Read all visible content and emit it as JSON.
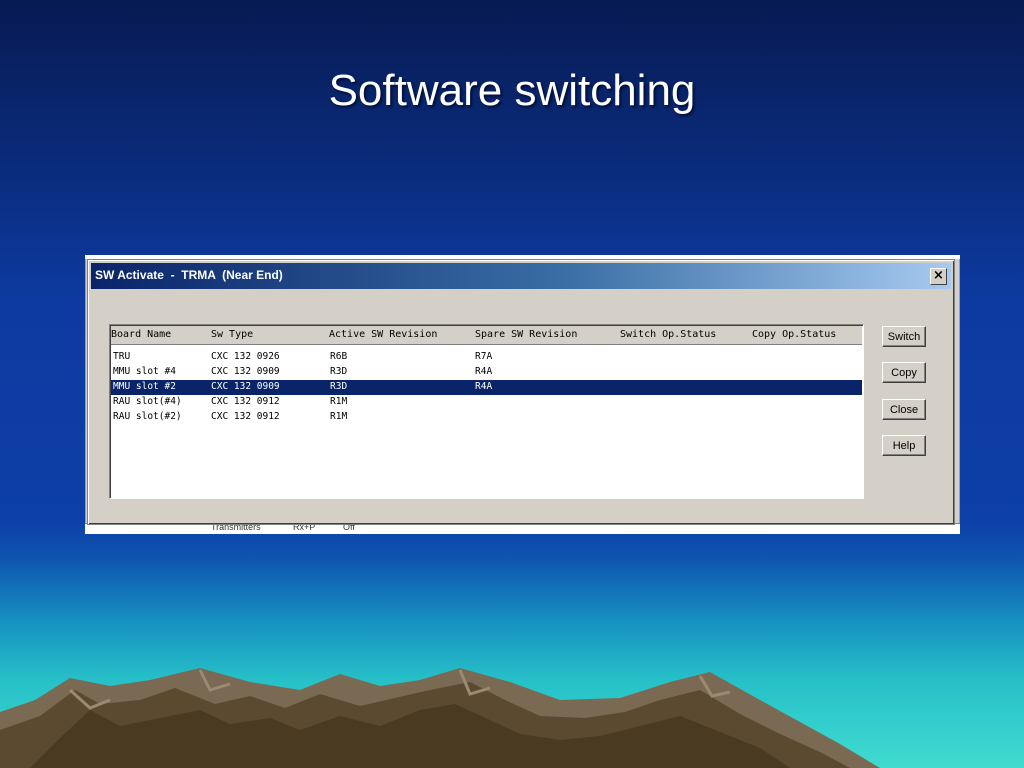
{
  "slide": {
    "title": "Software switching"
  },
  "dialog": {
    "title": "SW Activate  -  TRMA  (Near End)",
    "close_glyph": "×",
    "columns": [
      "Board Name",
      "Sw Type",
      "Active SW Revision",
      "Spare SW Revision",
      "Switch Op.Status",
      "Copy Op.Status"
    ],
    "rows": [
      {
        "board": "TRU",
        "sw_type": "CXC 132 0926",
        "active": "R6B",
        "spare": "R7A",
        "switch_status": "",
        "copy_status": ""
      },
      {
        "board": "MMU slot #4",
        "sw_type": "CXC 132 0909",
        "active": "R3D",
        "spare": "R4A",
        "switch_status": "",
        "copy_status": ""
      },
      {
        "board": "MMU slot #2",
        "sw_type": "CXC 132 0909",
        "active": "R3D",
        "spare": "R4A",
        "switch_status": "",
        "copy_status": "",
        "selected": true
      },
      {
        "board": "RAU slot(#4)",
        "sw_type": "CXC 132 0912",
        "active": "R1M",
        "spare": "",
        "switch_status": "",
        "copy_status": ""
      },
      {
        "board": "RAU slot(#2)",
        "sw_type": "CXC 132 0912",
        "active": "R1M",
        "spare": "",
        "switch_status": "",
        "copy_status": ""
      }
    ],
    "buttons": {
      "switch": "Switch",
      "copy": "Copy",
      "close": "Close",
      "help": "Help"
    }
  },
  "background_window": {
    "fragments": [
      "Transmitters",
      "Rx+P",
      "Off"
    ]
  },
  "colors": {
    "selection": "#0a246a",
    "titlebar_start": "#0a246a",
    "titlebar_end": "#a6caf0",
    "dialog_face": "#d4d0c8"
  }
}
